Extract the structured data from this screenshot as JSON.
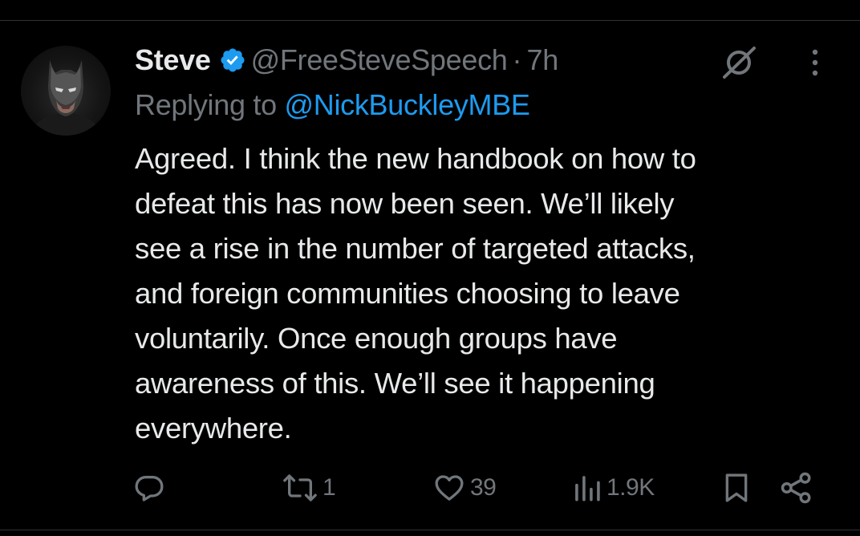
{
  "tweet": {
    "author": {
      "display_name": "Steve",
      "handle": "@FreeSteveSpeech",
      "verified": true,
      "avatar_icon": "batman-avatar"
    },
    "separator": "·",
    "timestamp": "7h",
    "replying_prefix": "Replying to",
    "replying_to": "@NickBuckleyMBE",
    "text_lines": [
      "Agreed. I think the new handbook on how to",
      "defeat this has now been seen. We’ll likely",
      "see a rise in the number of targeted attacks,",
      "and foreign communities choosing to leave",
      "voluntarily. Once enough groups have",
      "awareness of this. We’ll see it happening",
      "everywhere."
    ],
    "actions": {
      "reply_count": "",
      "retweet_count": "1",
      "like_count": "39",
      "views_count": "1.9K"
    }
  },
  "icons": {
    "verified": "verified-badge-icon",
    "grok": "grok-icon",
    "more": "more-options-icon",
    "reply": "reply-icon",
    "retweet": "retweet-icon",
    "like": "heart-icon",
    "views": "views-icon",
    "bookmark": "bookmark-icon",
    "share": "share-icon"
  },
  "colors": {
    "background": "#000000",
    "primary_text": "#e7e9ea",
    "secondary_text": "#71767b",
    "accent": "#1d9bf0"
  }
}
